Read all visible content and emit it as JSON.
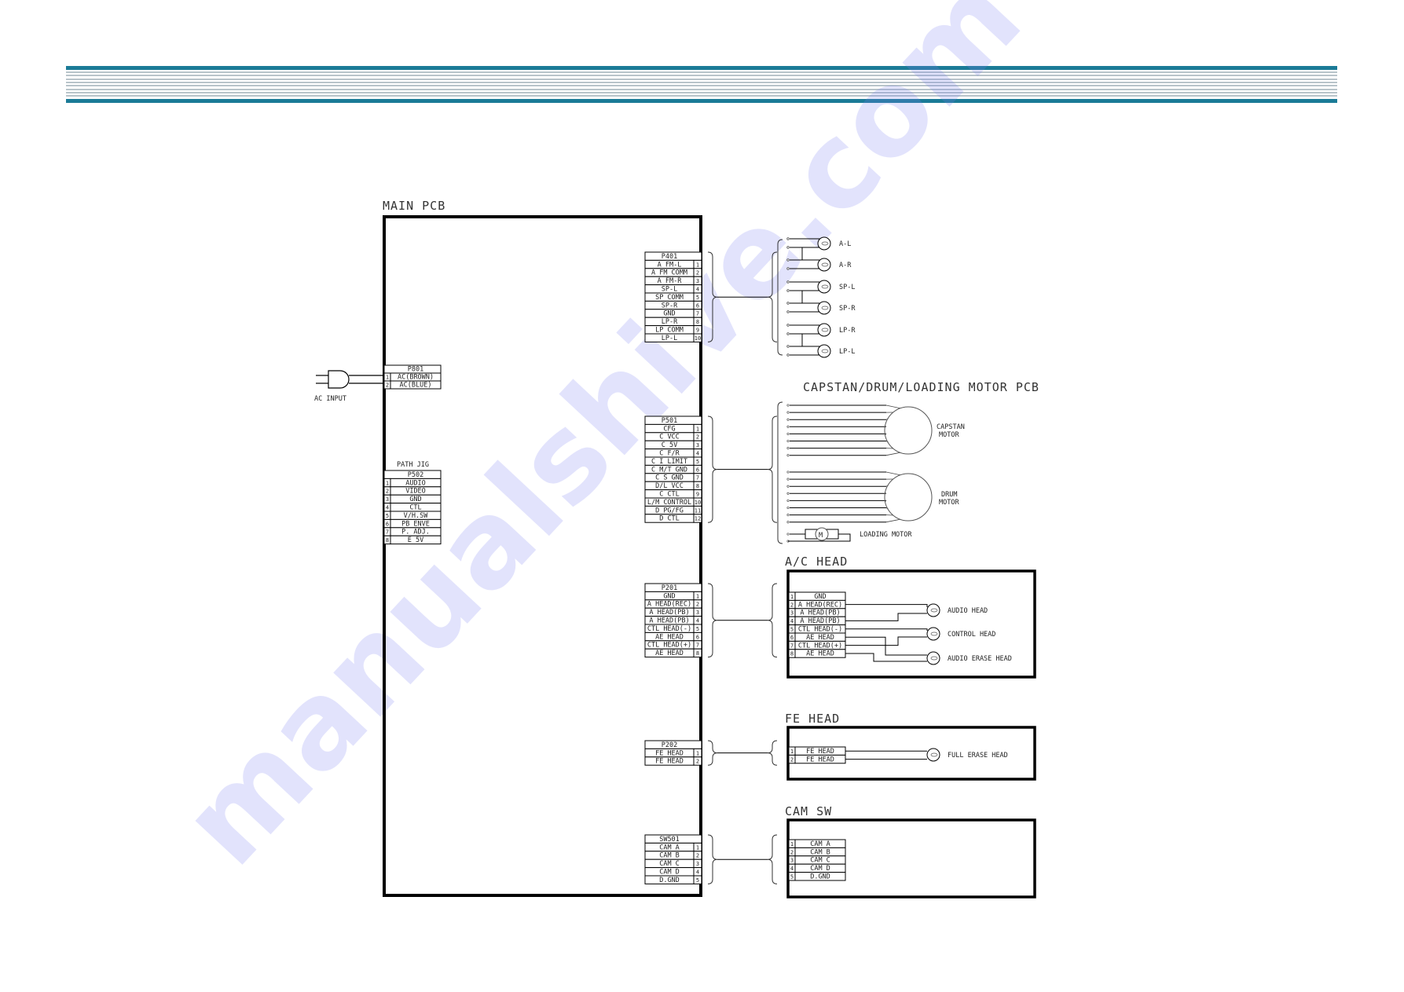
{
  "header_band": {
    "accent_color": "#1b7b97",
    "line_color": "#b8c4ca"
  },
  "watermark": "manualshive.com",
  "main_pcb": {
    "title": "MAIN PCB",
    "connectors": {
      "P401": {
        "name": "P401",
        "pins": [
          {
            "label": "A FM-L",
            "pin": "1"
          },
          {
            "label": "A FM COMM",
            "pin": "2"
          },
          {
            "label": "A FM-R",
            "pin": "3"
          },
          {
            "label": "SP-L",
            "pin": "4"
          },
          {
            "label": "SP COMM",
            "pin": "5"
          },
          {
            "label": "SP-R",
            "pin": "6"
          },
          {
            "label": "GND",
            "pin": "7"
          },
          {
            "label": "LP-R",
            "pin": "8"
          },
          {
            "label": "LP COMM",
            "pin": "9"
          },
          {
            "label": "LP-L",
            "pin": "10"
          }
        ]
      },
      "P801": {
        "name": "P801",
        "pins": [
          {
            "label": "AC(BROWN)",
            "pin": "1"
          },
          {
            "label": "AC(BLUE)",
            "pin": "2"
          }
        ]
      },
      "P502": {
        "name": "P502",
        "caption": "PATH JIG",
        "pins": [
          {
            "label": "AUDIO",
            "pin": "1"
          },
          {
            "label": "VIDEO",
            "pin": "2"
          },
          {
            "label": "GND",
            "pin": "3"
          },
          {
            "label": "CTL",
            "pin": "4"
          },
          {
            "label": "V/H.SW",
            "pin": "5"
          },
          {
            "label": "PB ENVE",
            "pin": "6"
          },
          {
            "label": "P. ADJ.",
            "pin": "7"
          },
          {
            "label": "E 5V",
            "pin": "8"
          }
        ]
      },
      "P501": {
        "name": "P501",
        "pins": [
          {
            "label": "CFG",
            "pin": "1"
          },
          {
            "label": "C VCC",
            "pin": "2"
          },
          {
            "label": "C 5V",
            "pin": "3"
          },
          {
            "label": "C F/R",
            "pin": "4"
          },
          {
            "label": "C I LIMIT",
            "pin": "5"
          },
          {
            "label": "C M/T GND",
            "pin": "6"
          },
          {
            "label": "C S GND",
            "pin": "7"
          },
          {
            "label": "D/L VCC",
            "pin": "8"
          },
          {
            "label": "C CTL",
            "pin": "9"
          },
          {
            "label": "L/M CONTROL",
            "pin": "10"
          },
          {
            "label": "D PG/FG",
            "pin": "11"
          },
          {
            "label": "D CTL",
            "pin": "12"
          }
        ]
      },
      "P201": {
        "name": "P201",
        "pins": [
          {
            "label": "GND",
            "pin": "1"
          },
          {
            "label": "A HEAD(REC)",
            "pin": "2"
          },
          {
            "label": "A HEAD(PB)",
            "pin": "3"
          },
          {
            "label": "A HEAD(PB)",
            "pin": "4"
          },
          {
            "label": "CTL HEAD(-)",
            "pin": "5"
          },
          {
            "label": "AE HEAD",
            "pin": "6"
          },
          {
            "label": "CTL HEAD(+)",
            "pin": "7"
          },
          {
            "label": "AE HEAD",
            "pin": "8"
          }
        ]
      },
      "P202": {
        "name": "P202",
        "pins": [
          {
            "label": "FE HEAD",
            "pin": "1"
          },
          {
            "label": "FE HEAD",
            "pin": "2"
          }
        ]
      },
      "SW501": {
        "name": "SW501",
        "pins": [
          {
            "label": "CAM A",
            "pin": "1"
          },
          {
            "label": "CAM B",
            "pin": "2"
          },
          {
            "label": "CAM C",
            "pin": "3"
          },
          {
            "label": "CAM D",
            "pin": "4"
          },
          {
            "label": "D.GND",
            "pin": "5"
          }
        ]
      }
    }
  },
  "ac_input": {
    "label": "AC INPUT"
  },
  "speakers": {
    "labels": [
      "A-L",
      "A-R",
      "SP-L",
      "SP-R",
      "LP-R",
      "LP-L"
    ]
  },
  "motor_pcb": {
    "title": "CAPSTAN/DRUM/LOADING MOTOR PCB",
    "capstan_label": [
      "CAPSTAN",
      "MOTOR"
    ],
    "drum_label": [
      "DRUM",
      "MOTOR"
    ],
    "loading_label": "LOADING MOTOR",
    "loading_symbol": "M"
  },
  "ac_head": {
    "title": "A/C HEAD",
    "pins": [
      {
        "pin": "1",
        "label": "GND"
      },
      {
        "pin": "2",
        "label": "A HEAD(REC)"
      },
      {
        "pin": "3",
        "label": "A HEAD(PB)"
      },
      {
        "pin": "4",
        "label": "A HEAD(PB)"
      },
      {
        "pin": "5",
        "label": "CTL HEAD(-)"
      },
      {
        "pin": "6",
        "label": "AE HEAD"
      },
      {
        "pin": "7",
        "label": "CTL HEAD(+)"
      },
      {
        "pin": "8",
        "label": "AE HEAD"
      }
    ],
    "heads": [
      "AUDIO HEAD",
      "CONTROL HEAD",
      "AUDIO ERASE HEAD"
    ]
  },
  "fe_head": {
    "title": "FE HEAD",
    "pins": [
      {
        "pin": "1",
        "label": "FE HEAD"
      },
      {
        "pin": "2",
        "label": "FE HEAD"
      }
    ],
    "head": "FULL ERASE HEAD"
  },
  "cam_sw": {
    "title": "CAM SW",
    "pins": [
      {
        "pin": "1",
        "label": "CAM A"
      },
      {
        "pin": "2",
        "label": "CAM B"
      },
      {
        "pin": "3",
        "label": "CAM C"
      },
      {
        "pin": "4",
        "label": "CAM D"
      },
      {
        "pin": "5",
        "label": "D.GND"
      }
    ]
  }
}
